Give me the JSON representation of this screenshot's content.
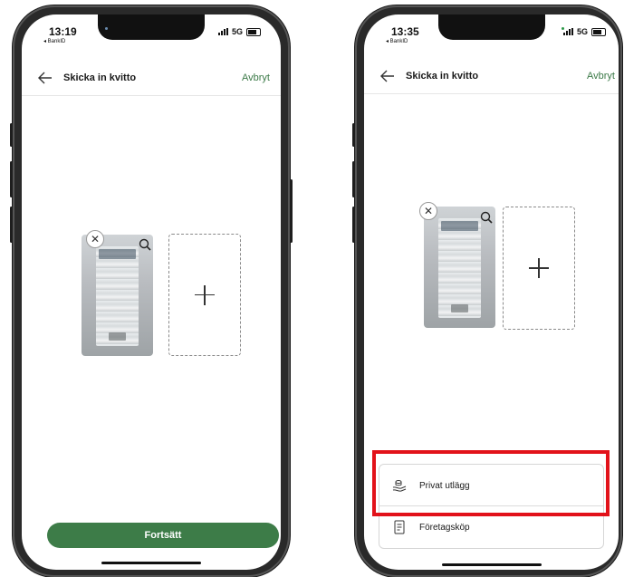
{
  "left_phone": {
    "status": {
      "time": "13:19",
      "back_app": "◂ BankID",
      "network": "5G"
    },
    "header": {
      "title": "Skicka in kvitto",
      "cancel": "Avbryt"
    },
    "remove_symbol": "✕",
    "primary_button": "Fortsätt"
  },
  "right_phone": {
    "status": {
      "time": "13:35",
      "back_app": "◂ BankID",
      "network": "5G"
    },
    "header": {
      "title": "Skicka in kvitto",
      "cancel": "Avbryt"
    },
    "remove_symbol": "✕",
    "options": [
      {
        "label": "Privat utlägg",
        "icon": "money-stack-icon"
      },
      {
        "label": "Företagsköp",
        "icon": "receipt-document-icon"
      }
    ]
  },
  "colors": {
    "brand_green": "#3d7c48",
    "cancel_green": "#3c7a48",
    "highlight_red": "#e2121a"
  }
}
